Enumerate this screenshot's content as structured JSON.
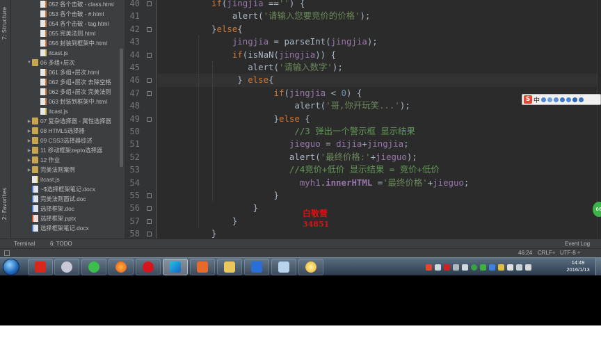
{
  "left_strip": {
    "structure_tab": "7: Structure",
    "favorites_tab": "2: Favorites"
  },
  "project_tree": [
    {
      "indent": 3,
      "arrow": "",
      "icon": "html",
      "label": "052 各个击破 - class.html"
    },
    {
      "indent": 3,
      "arrow": "",
      "icon": "html",
      "label": "053 各个击破 - #.html"
    },
    {
      "indent": 3,
      "arrow": "",
      "icon": "html",
      "label": "054 各个击破 - tag.html"
    },
    {
      "indent": 3,
      "arrow": "",
      "icon": "html",
      "label": "055 完美法则.html"
    },
    {
      "indent": 3,
      "arrow": "",
      "icon": "html",
      "label": "056 封装到框架中.html"
    },
    {
      "indent": 3,
      "arrow": "",
      "icon": "js",
      "label": "itcast.js"
    },
    {
      "indent": 2,
      "arrow": "▼",
      "icon": "folder",
      "label": "06 多组+层次"
    },
    {
      "indent": 3,
      "arrow": "",
      "icon": "html",
      "label": "061 多组+层次.html"
    },
    {
      "indent": 3,
      "arrow": "",
      "icon": "html",
      "label": "062 多组+层次 去除空格"
    },
    {
      "indent": 3,
      "arrow": "",
      "icon": "html",
      "label": "062 多组+层次 完美法则"
    },
    {
      "indent": 3,
      "arrow": "",
      "icon": "html",
      "label": "063 封装到框架中.html"
    },
    {
      "indent": 3,
      "arrow": "",
      "icon": "js",
      "label": "itcast.js"
    },
    {
      "indent": 2,
      "arrow": "▶",
      "icon": "folder",
      "label": "07 复杂选择器 - 属性选择器"
    },
    {
      "indent": 2,
      "arrow": "▶",
      "icon": "folder",
      "label": "08 HTML5选择器"
    },
    {
      "indent": 2,
      "arrow": "▶",
      "icon": "folder",
      "label": "09 CSS3选择器综述"
    },
    {
      "indent": 2,
      "arrow": "▶",
      "icon": "folder",
      "label": "11 移动框架zepto选择器"
    },
    {
      "indent": 2,
      "arrow": "▶",
      "icon": "folder",
      "label": "12 作业"
    },
    {
      "indent": 2,
      "arrow": "▶",
      "icon": "folder",
      "label": "完美法则案例"
    },
    {
      "indent": 2,
      "arrow": "",
      "icon": "js",
      "label": "itcast.js"
    },
    {
      "indent": 2,
      "arrow": "",
      "icon": "doc",
      "label": "~$选择框架笔记.docx"
    },
    {
      "indent": 2,
      "arrow": "",
      "icon": "doc",
      "label": "完美法则面试.doc"
    },
    {
      "indent": 2,
      "arrow": "",
      "icon": "doc",
      "label": "选择框架.doc"
    },
    {
      "indent": 2,
      "arrow": "",
      "icon": "ppt",
      "label": "选择框架.pptx"
    },
    {
      "indent": 2,
      "arrow": "",
      "icon": "doc",
      "label": "选择框架笔记.docx"
    }
  ],
  "editor": {
    "line_numbers": [
      "40",
      "41",
      "42",
      "43",
      "44",
      "45",
      "46",
      "47",
      "48",
      "49",
      "50",
      "51",
      "52",
      "53",
      "54",
      "55",
      "56",
      "57",
      "58"
    ],
    "highlight_line_index": 6,
    "code_lines": [
      [
        [
          "k",
          "if"
        ],
        [
          "p",
          "("
        ],
        [
          "v",
          "jingjia"
        ],
        [
          "p",
          " =="
        ],
        [
          "s",
          "''"
        ],
        [
          "p",
          ") {"
        ]
      ],
      [
        [
          "p",
          "    alert("
        ],
        [
          "s",
          "'请输入您要竞价的价格'"
        ],
        [
          "p",
          ");"
        ]
      ],
      [
        [
          "p",
          "}"
        ],
        [
          "k",
          "else"
        ],
        [
          "p",
          "{"
        ]
      ],
      [
        [
          "p",
          "    "
        ],
        [
          "v",
          "jingjia"
        ],
        [
          "p",
          " = parseInt("
        ],
        [
          "v",
          "jingjia"
        ],
        [
          "p",
          ");"
        ]
      ],
      [
        [
          "p",
          "    "
        ],
        [
          "k",
          "if"
        ],
        [
          "p",
          "(isNaN("
        ],
        [
          "v",
          "jingjia"
        ],
        [
          "p",
          ")) {"
        ]
      ],
      [
        [
          "p",
          "       alert("
        ],
        [
          "s",
          "'请输入数字'"
        ],
        [
          "p",
          ");"
        ]
      ],
      [
        [
          "p",
          "     } "
        ],
        [
          "k",
          "else"
        ],
        [
          "p",
          "{"
        ]
      ],
      [
        [
          "p",
          "            "
        ],
        [
          "k",
          "if"
        ],
        [
          "p",
          "("
        ],
        [
          "v",
          "jingjia"
        ],
        [
          "p",
          " < "
        ],
        [
          "n",
          "0"
        ],
        [
          "p",
          ") {"
        ]
      ],
      [
        [
          "p",
          "                alert("
        ],
        [
          "s",
          "'哥,你开玩笑...'"
        ],
        [
          "p",
          ");"
        ]
      ],
      [
        [
          "p",
          "            }"
        ],
        [
          "k",
          "else"
        ],
        [
          "p",
          " {"
        ]
      ],
      [
        [
          "c",
          "                //3 弹出一个警示框 显示结果"
        ]
      ],
      [
        [
          "p",
          "               "
        ],
        [
          "v",
          "jieguo"
        ],
        [
          "p",
          " = "
        ],
        [
          "v",
          "dijia"
        ],
        [
          "p",
          "+"
        ],
        [
          "v",
          "jingjia"
        ],
        [
          "p",
          ";"
        ]
      ],
      [
        [
          "p",
          "               alert("
        ],
        [
          "s",
          "'最终价格:'"
        ],
        [
          "p",
          "+"
        ],
        [
          "v",
          "jieguo"
        ],
        [
          "p",
          ");"
        ]
      ],
      [
        [
          "c",
          "               //4竞价+低价 显示结果 = 竞价+低价"
        ]
      ],
      [
        [
          "p",
          "                 "
        ],
        [
          "v",
          "myh1"
        ],
        [
          "p",
          "."
        ],
        [
          "b",
          "innerHTML"
        ],
        [
          "p",
          " ="
        ],
        [
          "s",
          "'最终价格'"
        ],
        [
          "p",
          "+"
        ],
        [
          "v",
          "jieguo"
        ],
        [
          "p",
          ";"
        ]
      ],
      [
        [
          "p",
          "            }"
        ]
      ],
      [
        [
          "p",
          "        }"
        ]
      ],
      [
        [
          "p",
          "    }"
        ]
      ],
      [
        [
          "p",
          "}"
        ]
      ]
    ],
    "watermark_name": "白敬营",
    "watermark_number": "34851"
  },
  "tool_window_bar": {
    "terminal": "Terminal",
    "todo": "6: TODO",
    "event_log": "Event Log"
  },
  "status_bar": {
    "position": "46:24",
    "line_sep": "CRLF÷",
    "encoding": "UTF-8 ÷"
  },
  "sogou_ime": {
    "mode": "中"
  },
  "taskbar": {
    "time": "14:49",
    "date": "2016/1/13"
  }
}
